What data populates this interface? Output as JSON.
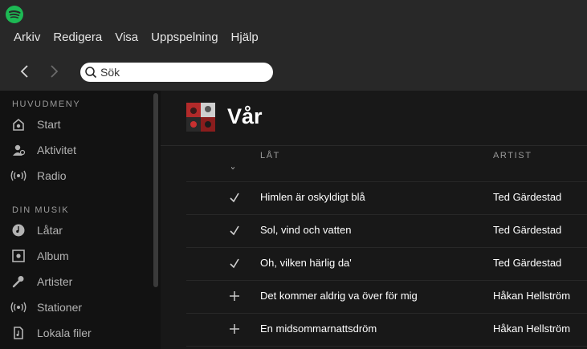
{
  "app": {
    "brand_color": "#1db954"
  },
  "menu": [
    "Arkiv",
    "Redigera",
    "Visa",
    "Uppspelning",
    "Hjälp"
  ],
  "nav": {
    "back_icon": "chevron-left-icon",
    "forward_icon": "chevron-right-icon"
  },
  "search": {
    "placeholder": "Sök"
  },
  "sidebar": {
    "main_title": "HUVUDMENY",
    "main_items": [
      {
        "label": "Start",
        "icon": "home-icon"
      },
      {
        "label": "Aktivitet",
        "icon": "activity-icon"
      },
      {
        "label": "Radio",
        "icon": "radio-icon"
      }
    ],
    "music_title": "DIN MUSIK",
    "music_items": [
      {
        "label": "Låtar",
        "icon": "songs-icon"
      },
      {
        "label": "Album",
        "icon": "album-icon"
      },
      {
        "label": "Artister",
        "icon": "microphone-icon"
      },
      {
        "label": "Stationer",
        "icon": "stations-icon"
      },
      {
        "label": "Lokala filer",
        "icon": "local-files-icon"
      }
    ]
  },
  "playlist": {
    "title": "Vår",
    "columns": {
      "song": "LÅT",
      "artist": "ARTIST"
    },
    "tracks": [
      {
        "title": "Himlen är oskyldigt blå",
        "artist": "Ted Gärdestad",
        "saved": true
      },
      {
        "title": "Sol, vind och vatten",
        "artist": "Ted Gärdestad",
        "saved": true
      },
      {
        "title": "Oh, vilken härlig da'",
        "artist": "Ted Gärdestad",
        "saved": true
      },
      {
        "title": "Det kommer aldrig va över för mig",
        "artist": "Håkan Hellström",
        "saved": false
      },
      {
        "title": "En midsommarnattsdröm",
        "artist": "Håkan Hellström",
        "saved": false
      }
    ]
  }
}
